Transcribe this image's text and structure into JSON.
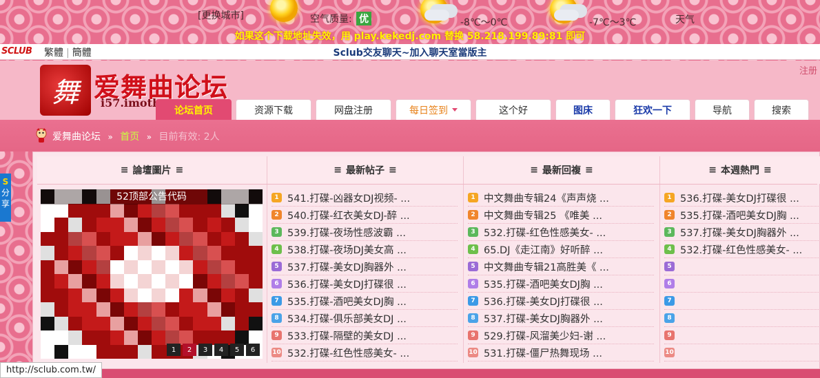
{
  "weather": {
    "change_city": "[更换城市]",
    "air_quality_label": "空气质量:",
    "air_quality_value": "优",
    "temp_1": "-8℃～0℃",
    "temp_2": "-7℃～3℃",
    "weather_label": "天气"
  },
  "notice": "如果这个下载地址失效，用 play.kekedj.com 替换 58.218.199.89:81 即可",
  "topbar": {
    "logo": "SCLUB",
    "lang_trad": "繁體",
    "lang_simp": "簡體",
    "center_text": "Sclub交友聊天~加入聊天室當版主"
  },
  "header": {
    "brand_icon_char": "舞",
    "brand_name": "爱舞曲论坛",
    "brand_sub": "i57.imoth",
    "register": "注册"
  },
  "nav": [
    {
      "label": "论坛首页",
      "style": "active",
      "w": 110
    },
    {
      "label": "资源下载",
      "style": "",
      "w": 110
    },
    {
      "label": "网盘注册",
      "style": "",
      "w": 110
    },
    {
      "label": "每日签到",
      "style": "orange",
      "w": 110,
      "caret": true
    },
    {
      "label": "这个好",
      "style": "",
      "w": 110
    },
    {
      "label": "图床",
      "style": "blue",
      "w": 80
    },
    {
      "label": "狂欢一下",
      "style": "blue",
      "w": 110
    },
    {
      "label": "导航",
      "style": "",
      "w": 80
    },
    {
      "label": "搜索",
      "style": "",
      "w": 80
    }
  ],
  "breadcrumb": {
    "forum": "爱舞曲论坛",
    "home": "首页",
    "online": "目前有效: 2人"
  },
  "side_badge": {
    "top": "S",
    "line1": "分",
    "line2": "享"
  },
  "columns": {
    "pics": "論壇圖片",
    "new_posts": "最新帖子",
    "new_replies": "最新回複",
    "hot_week": "本週熱門"
  },
  "slider": {
    "caption": "52顶部公告代码",
    "pages": [
      "1",
      "2",
      "3",
      "4",
      "5",
      "6"
    ],
    "active_page": "2"
  },
  "new_posts": [
    "541.打碟-凶器女DJ视频- ...",
    "540.打碟-红衣美女DJ-醉 ...",
    "539.打碟-夜场性感波霸 ...",
    "538.打碟-夜场DJ美女高 ...",
    "537.打碟-美女DJ胸器外 ...",
    "536.打碟-美女DJ打碟很 ...",
    "535.打碟-酒吧美女DJ胸 ...",
    "534.打碟-俱乐部美女DJ ...",
    "533.打碟-隔壁的美女DJ ...",
    "532.打碟-红色性感美女- ..."
  ],
  "new_replies": [
    "中文舞曲专辑24《声声烧 ...",
    "中文舞曲专辑25 《唯美 ...",
    "532.打碟-红色性感美女- ...",
    "65.DJ《走江南》好听醉 ...",
    "中文舞曲专辑21高胜美《 ...",
    "535.打碟-酒吧美女DJ胸 ...",
    "536.打碟-美女DJ打碟很 ...",
    "537.打碟-美女DJ胸器外 ...",
    "529.打碟-风溜美少妇-谢 ...",
    "531.打碟-僵尸热舞现场 ..."
  ],
  "hot_week": [
    "536.打碟-美女DJ打碟很 ...",
    "535.打碟-酒吧美女DJ胸 ...",
    "537.打碟-美女DJ胸器外 ...",
    "532.打碟-红色性感美女- ...",
    "",
    "",
    "",
    "",
    "",
    ""
  ],
  "status_url": "http://sclub.com.tw/"
}
